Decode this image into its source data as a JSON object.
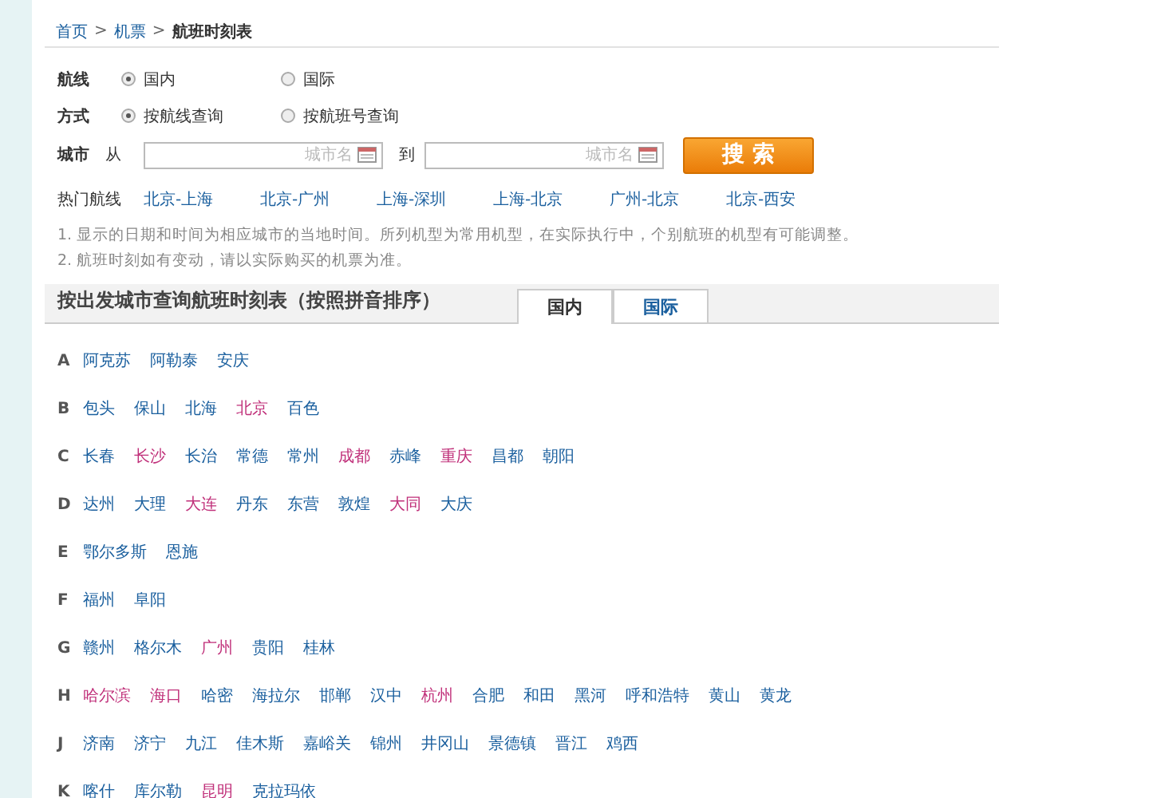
{
  "breadcrumb": [
    {
      "label": "首页",
      "kind": "link"
    },
    {
      "label": ">",
      "kind": "sep"
    },
    {
      "label": "机票",
      "kind": "link"
    },
    {
      "label": ">",
      "kind": "sep"
    },
    {
      "label": "航班时刻表",
      "kind": "current"
    }
  ],
  "form": {
    "route": {
      "label": "航线",
      "options": [
        {
          "label": "国内",
          "selected": true
        },
        {
          "label": "国际",
          "selected": false
        }
      ]
    },
    "method": {
      "label": "方式",
      "options": [
        {
          "label": "按航线查询",
          "selected": true
        },
        {
          "label": "按航班号查询",
          "selected": false
        }
      ]
    },
    "city": {
      "label": "城市",
      "from_label": "从",
      "from_placeholder": "城市名",
      "to_label": "到",
      "to_placeholder": "城市名"
    },
    "search_button": "搜 索"
  },
  "hot_routes": {
    "label": "热门航线",
    "items": [
      "北京-上海",
      "北京-广州",
      "上海-深圳",
      "上海-北京",
      "广州-北京",
      "北京-西安"
    ]
  },
  "notes": [
    "1. 显示的日期和时间为相应城市的当地时间。所列机型为常用机型，在实际执行中，个别航班的机型有可能调整。",
    "2. 航班时刻如有变动，请以实际购买的机票为准。"
  ],
  "section": {
    "title": "按出发城市查询航班时刻表（按照拼音排序）",
    "tabs": [
      {
        "label": "国内",
        "selected": true
      },
      {
        "label": "国际",
        "selected": false
      }
    ]
  },
  "groups": [
    {
      "letter": "A",
      "cities": [
        {
          "name": "阿克苏",
          "hot": false
        },
        {
          "name": "阿勒泰",
          "hot": false
        },
        {
          "name": "安庆",
          "hot": false
        }
      ]
    },
    {
      "letter": "B",
      "cities": [
        {
          "name": "包头",
          "hot": false
        },
        {
          "name": "保山",
          "hot": false
        },
        {
          "name": "北海",
          "hot": false
        },
        {
          "name": "北京",
          "hot": true
        },
        {
          "name": "百色",
          "hot": false
        }
      ]
    },
    {
      "letter": "C",
      "cities": [
        {
          "name": "长春",
          "hot": false
        },
        {
          "name": "长沙",
          "hot": true
        },
        {
          "name": "长治",
          "hot": false
        },
        {
          "name": "常德",
          "hot": false
        },
        {
          "name": "常州",
          "hot": false
        },
        {
          "name": "成都",
          "hot": true
        },
        {
          "name": "赤峰",
          "hot": false
        },
        {
          "name": "重庆",
          "hot": true
        },
        {
          "name": "昌都",
          "hot": false
        },
        {
          "name": "朝阳",
          "hot": false
        }
      ]
    },
    {
      "letter": "D",
      "cities": [
        {
          "name": "达州",
          "hot": false
        },
        {
          "name": "大理",
          "hot": false
        },
        {
          "name": "大连",
          "hot": true
        },
        {
          "name": "丹东",
          "hot": false
        },
        {
          "name": "东营",
          "hot": false
        },
        {
          "name": "敦煌",
          "hot": false
        },
        {
          "name": "大同",
          "hot": true
        },
        {
          "name": "大庆",
          "hot": false
        }
      ]
    },
    {
      "letter": "E",
      "cities": [
        {
          "name": "鄂尔多斯",
          "hot": false
        },
        {
          "name": "恩施",
          "hot": false
        }
      ]
    },
    {
      "letter": "F",
      "cities": [
        {
          "name": "福州",
          "hot": false
        },
        {
          "name": "阜阳",
          "hot": false
        }
      ]
    },
    {
      "letter": "G",
      "cities": [
        {
          "name": "赣州",
          "hot": false
        },
        {
          "name": "格尔木",
          "hot": false
        },
        {
          "name": "广州",
          "hot": true
        },
        {
          "name": "贵阳",
          "hot": false
        },
        {
          "name": "桂林",
          "hot": false
        }
      ]
    },
    {
      "letter": "H",
      "cities": [
        {
          "name": "哈尔滨",
          "hot": true
        },
        {
          "name": "海口",
          "hot": true
        },
        {
          "name": "哈密",
          "hot": false
        },
        {
          "name": "海拉尔",
          "hot": false
        },
        {
          "name": "邯郸",
          "hot": false
        },
        {
          "name": "汉中",
          "hot": false
        },
        {
          "name": "杭州",
          "hot": true
        },
        {
          "name": "合肥",
          "hot": false
        },
        {
          "name": "和田",
          "hot": false
        },
        {
          "name": "黑河",
          "hot": false
        },
        {
          "name": "呼和浩特",
          "hot": false
        },
        {
          "name": "黄山",
          "hot": false
        },
        {
          "name": "黄龙",
          "hot": false
        }
      ]
    },
    {
      "letter": "J",
      "cities": [
        {
          "name": "济南",
          "hot": false
        },
        {
          "name": "济宁",
          "hot": false
        },
        {
          "name": "九江",
          "hot": false
        },
        {
          "name": "佳木斯",
          "hot": false
        },
        {
          "name": "嘉峪关",
          "hot": false
        },
        {
          "name": "锦州",
          "hot": false
        },
        {
          "name": "井冈山",
          "hot": false
        },
        {
          "name": "景德镇",
          "hot": false
        },
        {
          "name": "晋江",
          "hot": false
        },
        {
          "name": "鸡西",
          "hot": false
        }
      ]
    },
    {
      "letter": "K",
      "cities": [
        {
          "name": "喀什",
          "hot": false
        },
        {
          "name": "库尔勒",
          "hot": false
        },
        {
          "name": "昆明",
          "hot": true
        },
        {
          "name": "克拉玛依",
          "hot": false
        }
      ]
    }
  ]
}
